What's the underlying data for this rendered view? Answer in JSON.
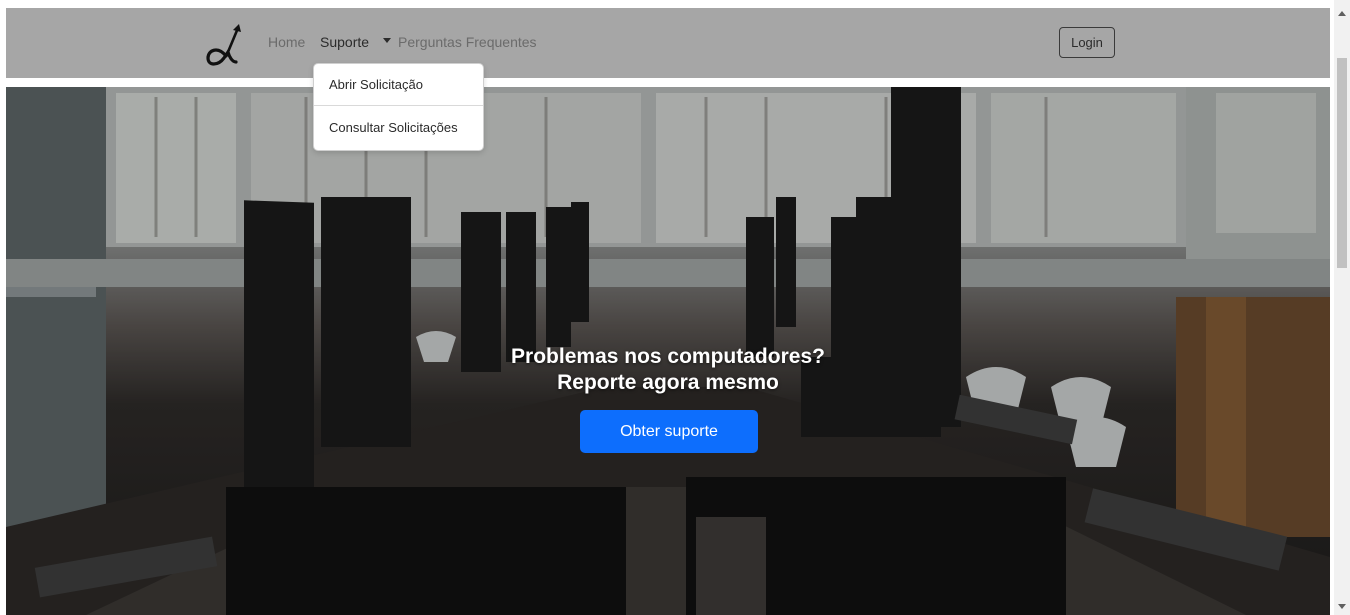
{
  "navbar": {
    "logo_icon": "alpha-arrow-logo-icon",
    "links": [
      {
        "label": "Home"
      },
      {
        "label": "Suporte"
      },
      {
        "label": "Perguntas Frequentes"
      }
    ],
    "login_label": "Login"
  },
  "dropdown": {
    "items": [
      {
        "label": "Abrir Solicitação"
      },
      {
        "label": "Consultar Solicitações"
      }
    ]
  },
  "hero": {
    "headline_line1": "Problemas nos computadores?",
    "headline_line2": "Reporte agora mesmo",
    "button_label": "Obter suporte",
    "button_color": "#0d6efd"
  }
}
